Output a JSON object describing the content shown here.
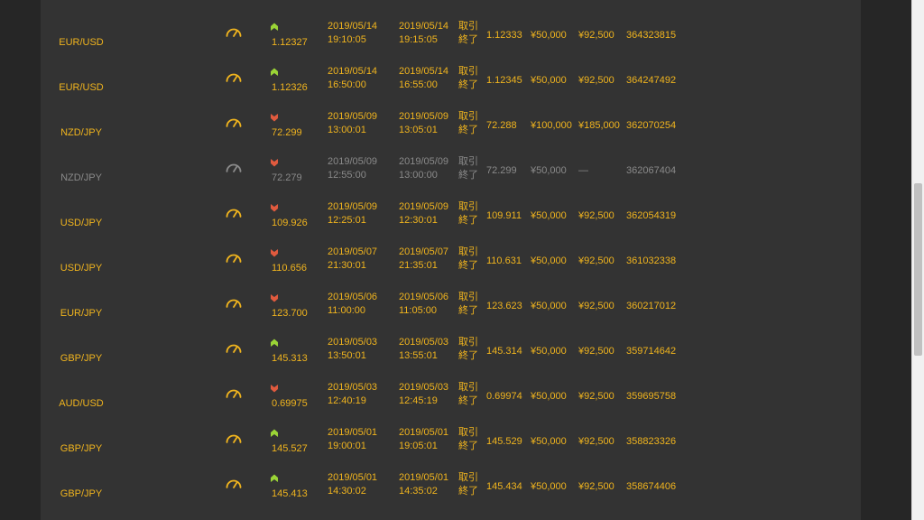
{
  "status_label": "取引終了",
  "colors": {
    "accent": "#f0b41e",
    "muted": "#8a8a8a",
    "up": "#9ad436",
    "down": "#e05a3e"
  },
  "rows": [
    {
      "pair": "EUR/USD",
      "direction": "up",
      "rate": "1.12327",
      "entry_date": "2019/05/14",
      "entry_time": "19:10:05",
      "exit_date": "2019/05/14",
      "exit_time": "19:15:05",
      "status": "取引終了",
      "close_rate": "1.12333",
      "amount": "¥50,000",
      "payout": "¥92,500",
      "ticket": "364323815",
      "muted": false
    },
    {
      "pair": "EUR/USD",
      "direction": "up",
      "rate": "1.12326",
      "entry_date": "2019/05/14",
      "entry_time": "16:50:00",
      "exit_date": "2019/05/14",
      "exit_time": "16:55:00",
      "status": "取引終了",
      "close_rate": "1.12345",
      "amount": "¥50,000",
      "payout": "¥92,500",
      "ticket": "364247492",
      "muted": false
    },
    {
      "pair": "NZD/JPY",
      "direction": "down",
      "rate": "72.299",
      "entry_date": "2019/05/09",
      "entry_time": "13:00:01",
      "exit_date": "2019/05/09",
      "exit_time": "13:05:01",
      "status": "取引終了",
      "close_rate": "72.288",
      "amount": "¥100,000",
      "payout": "¥185,000",
      "ticket": "362070254",
      "muted": false
    },
    {
      "pair": "NZD/JPY",
      "direction": "down",
      "rate": "72.279",
      "entry_date": "2019/05/09",
      "entry_time": "12:55:00",
      "exit_date": "2019/05/09",
      "exit_time": "13:00:00",
      "status": "取引終了",
      "close_rate": "72.299",
      "amount": "¥50,000",
      "payout": "—",
      "ticket": "362067404",
      "muted": true
    },
    {
      "pair": "USD/JPY",
      "direction": "down",
      "rate": "109.926",
      "entry_date": "2019/05/09",
      "entry_time": "12:25:01",
      "exit_date": "2019/05/09",
      "exit_time": "12:30:01",
      "status": "取引終了",
      "close_rate": "109.911",
      "amount": "¥50,000",
      "payout": "¥92,500",
      "ticket": "362054319",
      "muted": false
    },
    {
      "pair": "USD/JPY",
      "direction": "down",
      "rate": "110.656",
      "entry_date": "2019/05/07",
      "entry_time": "21:30:01",
      "exit_date": "2019/05/07",
      "exit_time": "21:35:01",
      "status": "取引終了",
      "close_rate": "110.631",
      "amount": "¥50,000",
      "payout": "¥92,500",
      "ticket": "361032338",
      "muted": false
    },
    {
      "pair": "EUR/JPY",
      "direction": "down",
      "rate": "123.700",
      "entry_date": "2019/05/06",
      "entry_time": "11:00:00",
      "exit_date": "2019/05/06",
      "exit_time": "11:05:00",
      "status": "取引終了",
      "close_rate": "123.623",
      "amount": "¥50,000",
      "payout": "¥92,500",
      "ticket": "360217012",
      "muted": false
    },
    {
      "pair": "GBP/JPY",
      "direction": "up",
      "rate": "145.313",
      "entry_date": "2019/05/03",
      "entry_time": "13:50:01",
      "exit_date": "2019/05/03",
      "exit_time": "13:55:01",
      "status": "取引終了",
      "close_rate": "145.314",
      "amount": "¥50,000",
      "payout": "¥92,500",
      "ticket": "359714642",
      "muted": false
    },
    {
      "pair": "AUD/USD",
      "direction": "down",
      "rate": "0.69975",
      "entry_date": "2019/05/03",
      "entry_time": "12:40:19",
      "exit_date": "2019/05/03",
      "exit_time": "12:45:19",
      "status": "取引終了",
      "close_rate": "0.69974",
      "amount": "¥50,000",
      "payout": "¥92,500",
      "ticket": "359695758",
      "muted": false
    },
    {
      "pair": "GBP/JPY",
      "direction": "up",
      "rate": "145.527",
      "entry_date": "2019/05/01",
      "entry_time": "19:00:01",
      "exit_date": "2019/05/01",
      "exit_time": "19:05:01",
      "status": "取引終了",
      "close_rate": "145.529",
      "amount": "¥50,000",
      "payout": "¥92,500",
      "ticket": "358823326",
      "muted": false
    },
    {
      "pair": "GBP/JPY",
      "direction": "up",
      "rate": "145.413",
      "entry_date": "2019/05/01",
      "entry_time": "14:30:02",
      "exit_date": "2019/05/01",
      "exit_time": "14:35:02",
      "status": "取引終了",
      "close_rate": "145.434",
      "amount": "¥50,000",
      "payout": "¥92,500",
      "ticket": "358674406",
      "muted": false
    }
  ]
}
